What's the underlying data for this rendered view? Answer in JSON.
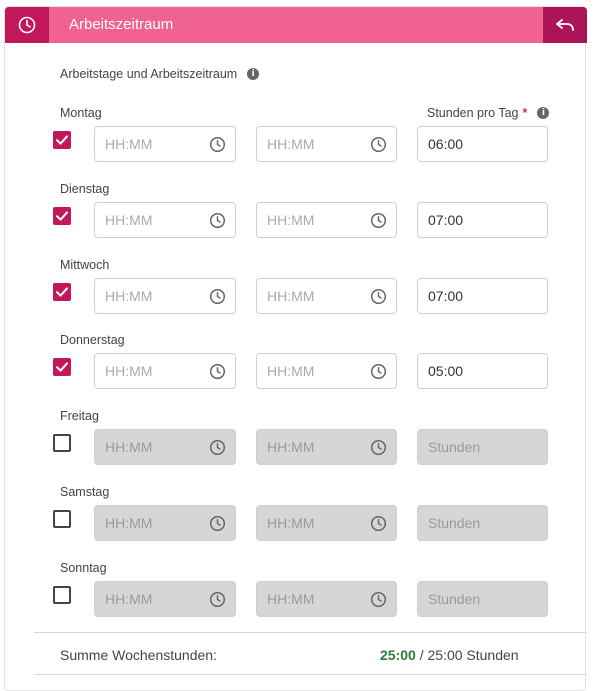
{
  "header": {
    "title": "Arbeitszeitraum",
    "left_icon": "clock-icon",
    "right_icon": "undo-icon",
    "colors": {
      "bar": "#f06292",
      "icon_box": "#c2185b",
      "undo_box": "#ad1457"
    }
  },
  "section_title": "Arbeitstage und Arbeitszeitraum",
  "hours_header": {
    "label": "Stunden pro Tag",
    "required": "*"
  },
  "days": [
    {
      "name": "Montag",
      "checked": true,
      "start_placeholder": "HH:MM",
      "end_placeholder": "HH:MM",
      "hours": "06:00",
      "hours_placeholder": "Stunden"
    },
    {
      "name": "Dienstag",
      "checked": true,
      "start_placeholder": "HH:MM",
      "end_placeholder": "HH:MM",
      "hours": "07:00",
      "hours_placeholder": "Stunden"
    },
    {
      "name": "Mittwoch",
      "checked": true,
      "start_placeholder": "HH:MM",
      "end_placeholder": "HH:MM",
      "hours": "07:00",
      "hours_placeholder": "Stunden"
    },
    {
      "name": "Donnerstag",
      "checked": true,
      "start_placeholder": "HH:MM",
      "end_placeholder": "HH:MM",
      "hours": "05:00",
      "hours_placeholder": "Stunden"
    },
    {
      "name": "Freitag",
      "checked": false,
      "start_placeholder": "HH:MM",
      "end_placeholder": "HH:MM",
      "hours": "",
      "hours_placeholder": "Stunden"
    },
    {
      "name": "Samstag",
      "checked": false,
      "start_placeholder": "HH:MM",
      "end_placeholder": "HH:MM",
      "hours": "",
      "hours_placeholder": "Stunden"
    },
    {
      "name": "Sonntag",
      "checked": false,
      "start_placeholder": "HH:MM",
      "end_placeholder": "HH:MM",
      "hours": "",
      "hours_placeholder": "Stunden"
    }
  ],
  "summary": {
    "label": "Summe Wochenstunden:",
    "current": "25:00",
    "separator": " / ",
    "target": "25:00 Stunden",
    "current_color": "#2e7d32"
  }
}
